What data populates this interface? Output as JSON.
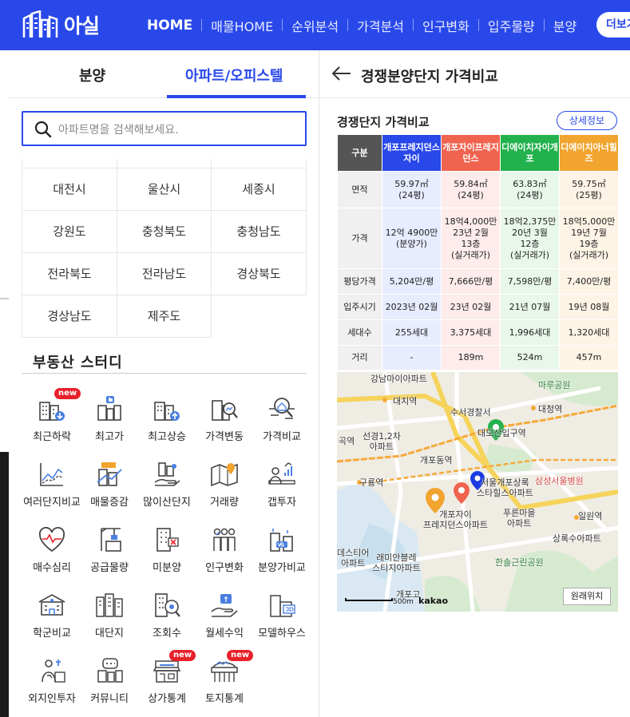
{
  "brand": {
    "name": "아실"
  },
  "nav": {
    "items": [
      "HOME",
      "매물HOME",
      "순위분석",
      "가격분석",
      "인구변화",
      "입주물량",
      "분양"
    ],
    "more_label": "더보기"
  },
  "left": {
    "tabs": [
      "분양",
      "아파트/오피스텔"
    ],
    "active_tab": 1,
    "search_placeholder": "아파트명을 검색해보세요.",
    "regions": [
      "대전시",
      "울산시",
      "세종시",
      "강원도",
      "충청북도",
      "충청남도",
      "전라북도",
      "전라남도",
      "경상북도",
      "경상남도",
      "제주도"
    ],
    "study": {
      "title": "부동산 스터디",
      "items": [
        {
          "label": "최근하락",
          "badge": "new",
          "icon": "building-down-icon"
        },
        {
          "label": "최고가",
          "badge": "",
          "icon": "building-thumb-icon"
        },
        {
          "label": "최고상승",
          "badge": "",
          "icon": "building-up-icon"
        },
        {
          "label": "가격변동",
          "badge": "",
          "icon": "building-magnifier-icon"
        },
        {
          "label": "가격비교",
          "badge": "",
          "icon": "compare-magnifier-icon"
        },
        {
          "label": "여러단지비교",
          "badge": "",
          "icon": "line-chart-icon"
        },
        {
          "label": "매물증감",
          "badge": "",
          "icon": "listing-chart-icon"
        },
        {
          "label": "많이산단지",
          "badge": "",
          "icon": "hand-buildings-icon"
        },
        {
          "label": "거래량",
          "badge": "",
          "icon": "map-pin-icon"
        },
        {
          "label": "갭투자",
          "badge": "",
          "icon": "person-chart-icon"
        },
        {
          "label": "매수심리",
          "badge": "",
          "icon": "heartbeat-icon"
        },
        {
          "label": "공급물량",
          "badge": "",
          "icon": "crane-icon"
        },
        {
          "label": "미분양",
          "badge": "",
          "icon": "building-x-icon"
        },
        {
          "label": "인구변화",
          "badge": "",
          "icon": "people-icon"
        },
        {
          "label": "분양가비교",
          "badge": "",
          "icon": "buildings-vs-icon"
        },
        {
          "label": "학군비교",
          "badge": "",
          "icon": "school-icon"
        },
        {
          "label": "대단지",
          "badge": "",
          "icon": "large-complex-icon"
        },
        {
          "label": "조회수",
          "badge": "",
          "icon": "building-eye-icon"
        },
        {
          "label": "월세수익",
          "badge": "",
          "icon": "money-hand-icon"
        },
        {
          "label": "모델하우스",
          "badge": "",
          "icon": "model-house-icon"
        },
        {
          "label": "외지인투자",
          "badge": "",
          "icon": "investor-icon"
        },
        {
          "label": "커뮤니티",
          "badge": "",
          "icon": "community-icon"
        },
        {
          "label": "상가통계",
          "badge": "new",
          "icon": "shop-icon"
        },
        {
          "label": "토지통계",
          "badge": "new",
          "icon": "land-icon"
        }
      ]
    }
  },
  "right": {
    "header_title": "경쟁분양단지 가격비교",
    "compare_title": "경쟁단지 가격비교",
    "detail_label": "상세정보",
    "table": {
      "header_label": "구분",
      "columns": [
        {
          "name": "개포프레지던스자이",
          "color": "#2948ea",
          "bg": "#e8ecff"
        },
        {
          "name": "개포자이프레지던스",
          "color": "#f0634e",
          "bg": "#fdeceb"
        },
        {
          "name": "디에이치자이개포",
          "color": "#22b14c",
          "bg": "#e9f7ea"
        },
        {
          "name": "디에이치아너힐즈",
          "color": "#f1a42e",
          "bg": "#fef4e6"
        }
      ],
      "rows": [
        {
          "label": "면적",
          "cells": [
            "59.97㎡\n(24평)",
            "59.84㎡\n(24평)",
            "63.83㎡\n(24평)",
            "59.75㎡\n(25평)"
          ]
        },
        {
          "label": "가격",
          "cells": [
            "12억 4900만\n(분양가)",
            "18억4,000만\n23년 2월\n13층\n(실거래가)",
            "18억2,375만\n20년 3월\n12층\n(실거래가)",
            "18억5,000만\n19년 7월\n19층\n(실거래가)"
          ]
        },
        {
          "label": "평당가격",
          "cells": [
            "5,204만/평",
            "7,666만/평",
            "7,598만/평",
            "7,400만/평"
          ]
        },
        {
          "label": "입주시기",
          "cells": [
            "2023년 02월",
            "23년 02월",
            "21년 07월",
            "19년 08월"
          ]
        },
        {
          "label": "세대수",
          "cells": [
            "255세대",
            "3,375세대",
            "1,996세대",
            "1,320세대"
          ]
        },
        {
          "label": "거리",
          "cells": [
            "-",
            "189m",
            "524m",
            "457m"
          ]
        }
      ]
    },
    "map": {
      "labels": [
        {
          "t": "강남마이아파트"
        },
        {
          "t": "대치역"
        },
        {
          "t": "마루공원"
        },
        {
          "t": "수서경찰서"
        },
        {
          "t": "대청역"
        },
        {
          "t": "대모산입구역"
        },
        {
          "t": "곡역"
        },
        {
          "t": "선경1,2차\n아파트"
        },
        {
          "t": "개포동역"
        },
        {
          "t": "구룡역"
        },
        {
          "t": "서울개포상록\n스타힐스아파트"
        },
        {
          "t": "삼성서울병원"
        },
        {
          "t": "개포자이\n프레지던스아파트"
        },
        {
          "t": "푸른마을\n아파트"
        },
        {
          "t": "일원역"
        },
        {
          "t": "상록수아파트"
        },
        {
          "t": "데스티어\n아파트"
        },
        {
          "t": "래미안블레\n스티지아파트"
        },
        {
          "t": "한솔근린공원"
        },
        {
          "t": "개포고"
        }
      ],
      "scale_label": "500m",
      "provider": "kakao",
      "origin_button": "원래위치"
    }
  }
}
